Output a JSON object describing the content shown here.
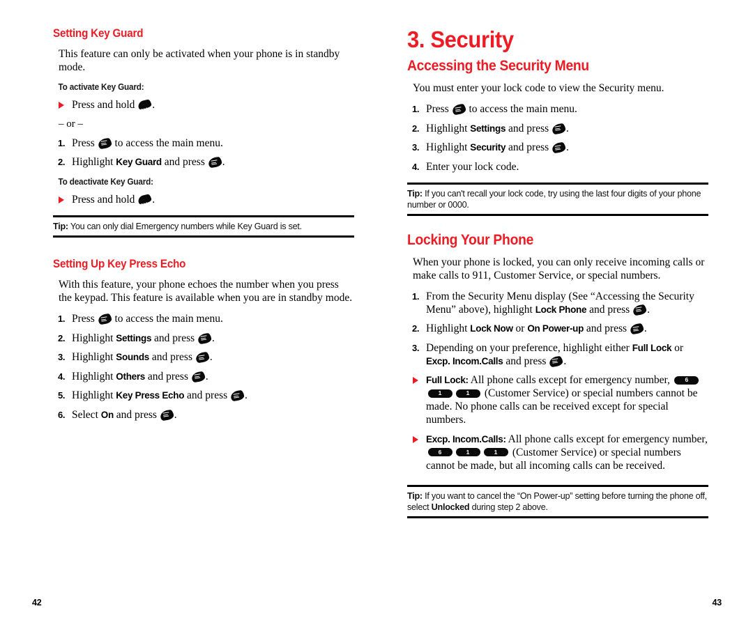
{
  "document": {
    "accent_color": "#ED1C24",
    "text_color": "#000000"
  },
  "icons": {
    "menu_key_label": "menu",
    "back_key_label": "BACK",
    "arrow_bullet": "red-triangle"
  },
  "left_page": {
    "folio": "42",
    "section_heading": "Setting Key Guard",
    "intro_paragraph": "This feature can only be activated when your phone is in standby mode.",
    "activate_label": "To activate Key Guard:",
    "activate_bullet_prefix": "Press and hold",
    "activate_bullet_suffix": ".",
    "or_separator": "– or –",
    "activate_steps": [
      {
        "num": "1.",
        "pre": "Press",
        "mid": "to access the main menu.",
        "bold": "",
        "post": ""
      },
      {
        "num": "2.",
        "pre": "Highlight",
        "bold": "Key Guard",
        "mid": "and press",
        "post": "."
      }
    ],
    "deactivate_label": "To deactivate Key Guard:",
    "deactivate_bullet_prefix": "Press and hold",
    "deactivate_bullet_suffix": ".",
    "tip": {
      "label": "Tip:",
      "text": " You can only dial Emergency numbers while Key Guard is set."
    },
    "echo_heading": "Setting Up Key Press Echo",
    "echo_paragraph": "With this feature, your phone echoes the number when you press the keypad. This feature is available when you are in standby mode.",
    "echo_steps": [
      {
        "num": "1.",
        "pre": "Press",
        "bold": "",
        "mid": "to access the main menu.",
        "post": ""
      },
      {
        "num": "2.",
        "pre": "Highlight",
        "bold": "Settings",
        "mid": "and press",
        "post": "."
      },
      {
        "num": "3.",
        "pre": "Highlight",
        "bold": "Sounds",
        "mid": "and press",
        "post": "."
      },
      {
        "num": "4.",
        "pre": "Highlight",
        "bold": "Others",
        "mid": "and press",
        "post": "."
      },
      {
        "num": "5.",
        "pre": "Highlight",
        "bold": "Key Press Echo",
        "mid": "and press",
        "post": "."
      },
      {
        "num": "6.",
        "pre": "Select",
        "bold": "On",
        "mid": "and press",
        "post": "."
      }
    ]
  },
  "right_page": {
    "folio": "43",
    "chapter_title": "3. Security",
    "access_heading": "Accessing the Security Menu",
    "access_paragraph": "You must enter your lock code to view the Security menu.",
    "access_steps": [
      {
        "num": "1.",
        "pre": "Press",
        "bold": "",
        "mid": "to access the main menu.",
        "post": ""
      },
      {
        "num": "2.",
        "pre": "Highlight",
        "bold": "Settings",
        "mid": "and press",
        "post": "."
      },
      {
        "num": "3.",
        "pre": "Highlight",
        "bold": "Security",
        "mid": "and press",
        "post": "."
      }
    ],
    "access_step4": {
      "num": "4.",
      "text": "Enter your lock code."
    },
    "tip_lock_code": {
      "label": "Tip:",
      "text": " If you can't recall your lock code, try using the last four digits of your phone number or 0000."
    },
    "locking_heading": "Locking Your Phone",
    "locking_paragraph": "When your phone is locked, you can only receive incoming calls or make calls to 911, Customer Service, or special numbers.",
    "lock_step1_a": "From the Security Menu display (See “Accessing the Security Menu” above), highlight",
    "lock_step1_bold": "Lock Phone",
    "lock_step1_b": "and press",
    "lock_step1_end": ".",
    "lock_step2_pre": "Highlight",
    "lock_step2_bold1": "Lock Now",
    "lock_step2_or": "or",
    "lock_step2_bold2": "On Power-up",
    "lock_step2_post": "and press",
    "lock_step2_end": ".",
    "lock_step3_pre": "Depending on your preference, highlight either",
    "lock_step3_bold1": "Full Lock",
    "lock_step3_or": "or",
    "lock_step3_bold2": "Excp. Incom.Calls",
    "lock_step3_post": "and press",
    "lock_step3_end": ".",
    "full_lock_bullet": {
      "term": "Full Lock:",
      "text_a": " All phone calls except for emergency number,",
      "keys": [
        "6",
        "1",
        "1"
      ],
      "text_b": "(Customer Service) or special numbers cannot be made. No phone calls can be received except for special numbers."
    },
    "excp_bullet": {
      "term": "Excp. Incom.Calls:",
      "text_a": " All phone calls except for emergency number,",
      "keys": [
        "6",
        "1",
        "1"
      ],
      "text_b": "(Customer Service) or special numbers cannot be made, but all incoming calls can be received."
    },
    "tip_power_up": {
      "label": "Tip:",
      "text_a": " If you want to cancel the “On Power-up” setting before turning the phone off, select ",
      "bold": "Unlocked",
      "text_b": " during step 2 above."
    }
  }
}
